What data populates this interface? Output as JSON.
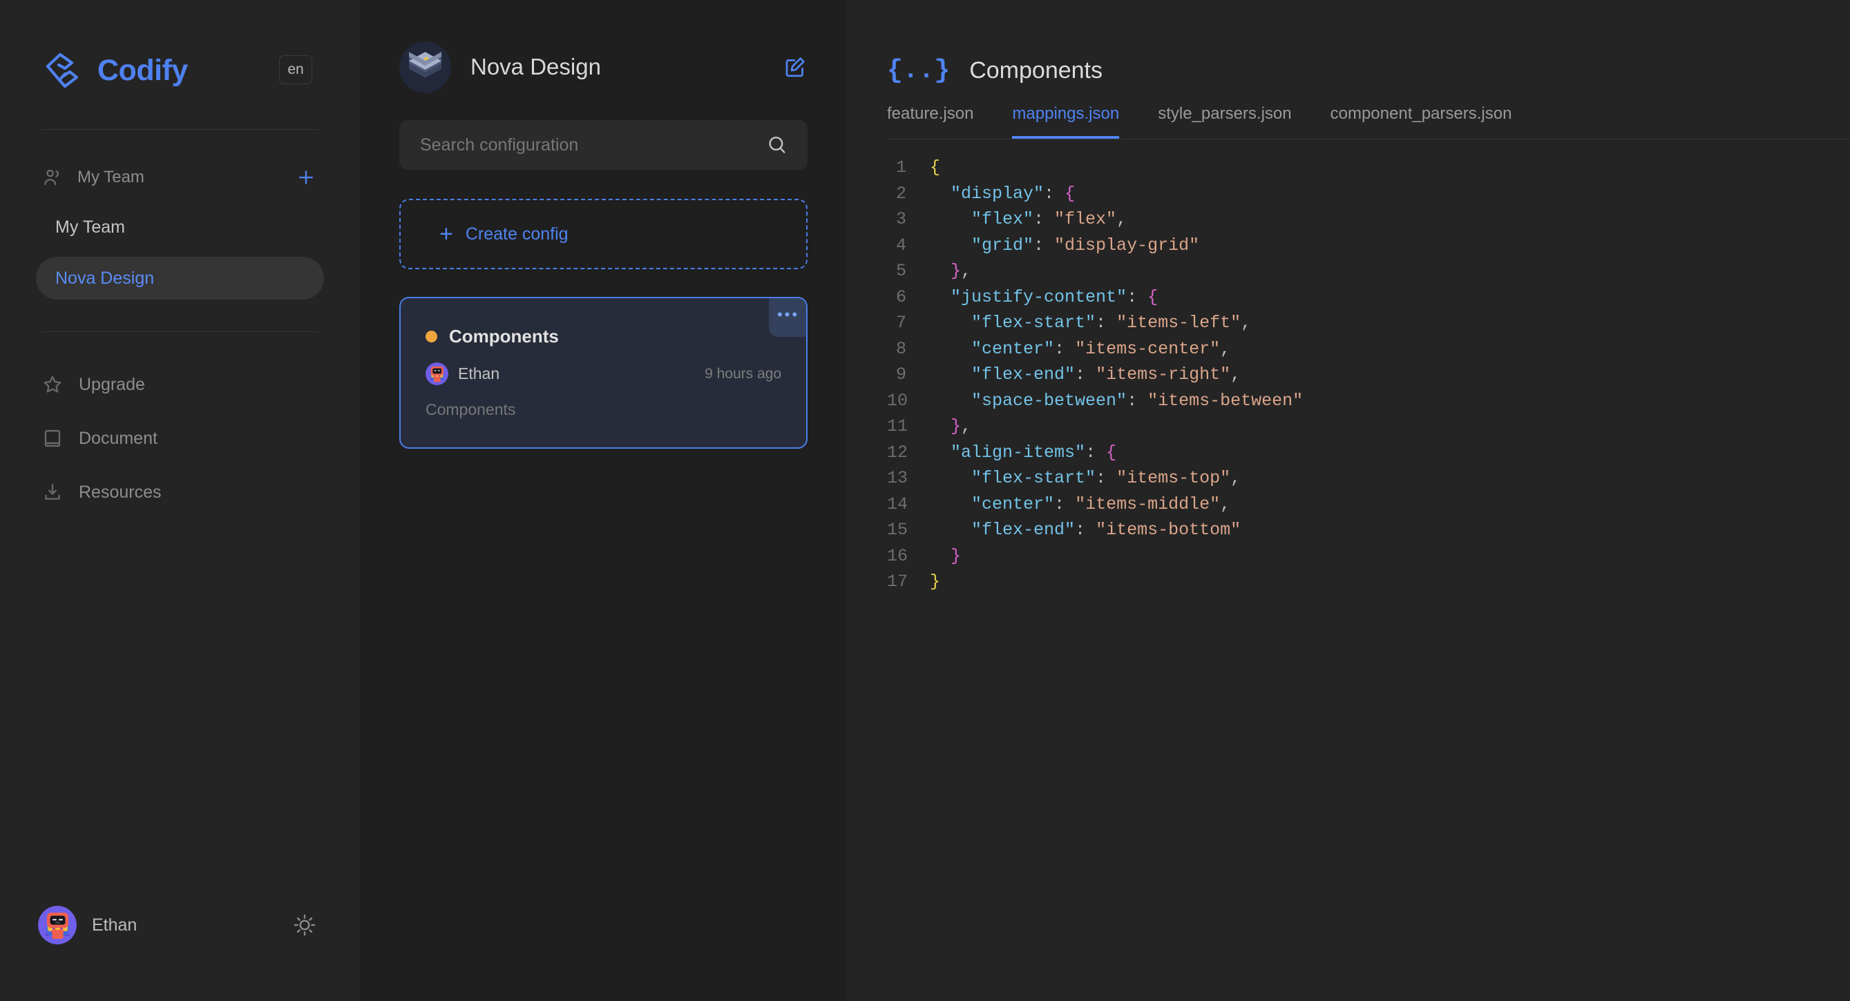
{
  "brand": {
    "name": "Codify",
    "lang_badge": "en"
  },
  "sidebar": {
    "team_section": {
      "label": "My Team",
      "add_label": "+"
    },
    "teams": [
      {
        "label": "My Team",
        "active": false
      },
      {
        "label": "Nova Design",
        "active": true
      }
    ],
    "nav": [
      {
        "label": "Upgrade",
        "icon": "star-icon"
      },
      {
        "label": "Document",
        "icon": "book-icon"
      },
      {
        "label": "Resources",
        "icon": "download-icon"
      }
    ],
    "user": {
      "name": "Ethan",
      "avatar": "robot-avatar",
      "theme_icon": "sun-icon"
    }
  },
  "middle": {
    "project_title": "Nova Design",
    "project_icon": "isometric-cube-icon",
    "edit_icon": "edit-square-icon",
    "search": {
      "value": "",
      "placeholder": "Search configuration",
      "icon": "search-icon"
    },
    "create_config": {
      "label": "Create config",
      "plus": "+"
    },
    "config_card": {
      "title": "Components",
      "status_color": "#f0a63c",
      "author": "Ethan",
      "timestamp": "9 hours ago",
      "description": "Components",
      "menu": "•••"
    }
  },
  "right": {
    "icon": "{..}",
    "title": "Components",
    "tabs": [
      {
        "label": "feature.json",
        "active": false
      },
      {
        "label": "mappings.json",
        "active": true
      },
      {
        "label": "style_parsers.json",
        "active": false
      },
      {
        "label": "component_parsers.json",
        "active": false
      }
    ],
    "code_lines": [
      {
        "n": "1",
        "tokens": [
          {
            "t": "{",
            "c": "br0"
          }
        ]
      },
      {
        "n": "2",
        "tokens": [
          {
            "t": "  ",
            "c": "pun"
          },
          {
            "t": "\"display\"",
            "c": "key"
          },
          {
            "t": ": ",
            "c": "pun"
          },
          {
            "t": "{",
            "c": "br1"
          }
        ]
      },
      {
        "n": "3",
        "tokens": [
          {
            "t": "    ",
            "c": "pun"
          },
          {
            "t": "\"flex\"",
            "c": "key"
          },
          {
            "t": ": ",
            "c": "pun"
          },
          {
            "t": "\"flex\"",
            "c": "str"
          },
          {
            "t": ",",
            "c": "pun"
          }
        ]
      },
      {
        "n": "4",
        "tokens": [
          {
            "t": "    ",
            "c": "pun"
          },
          {
            "t": "\"grid\"",
            "c": "key"
          },
          {
            "t": ": ",
            "c": "pun"
          },
          {
            "t": "\"display-grid\"",
            "c": "str"
          }
        ]
      },
      {
        "n": "5",
        "tokens": [
          {
            "t": "  ",
            "c": "pun"
          },
          {
            "t": "}",
            "c": "br1"
          },
          {
            "t": ",",
            "c": "pun"
          }
        ]
      },
      {
        "n": "6",
        "tokens": [
          {
            "t": "  ",
            "c": "pun"
          },
          {
            "t": "\"justify-content\"",
            "c": "key"
          },
          {
            "t": ": ",
            "c": "pun"
          },
          {
            "t": "{",
            "c": "br1"
          }
        ]
      },
      {
        "n": "7",
        "tokens": [
          {
            "t": "    ",
            "c": "pun"
          },
          {
            "t": "\"flex-start\"",
            "c": "key"
          },
          {
            "t": ": ",
            "c": "pun"
          },
          {
            "t": "\"items-left\"",
            "c": "str"
          },
          {
            "t": ",",
            "c": "pun"
          }
        ]
      },
      {
        "n": "8",
        "tokens": [
          {
            "t": "    ",
            "c": "pun"
          },
          {
            "t": "\"center\"",
            "c": "key"
          },
          {
            "t": ": ",
            "c": "pun"
          },
          {
            "t": "\"items-center\"",
            "c": "str"
          },
          {
            "t": ",",
            "c": "pun"
          }
        ]
      },
      {
        "n": "9",
        "tokens": [
          {
            "t": "    ",
            "c": "pun"
          },
          {
            "t": "\"flex-end\"",
            "c": "key"
          },
          {
            "t": ": ",
            "c": "pun"
          },
          {
            "t": "\"items-right\"",
            "c": "str"
          },
          {
            "t": ",",
            "c": "pun"
          }
        ]
      },
      {
        "n": "10",
        "tokens": [
          {
            "t": "    ",
            "c": "pun"
          },
          {
            "t": "\"space-between\"",
            "c": "key"
          },
          {
            "t": ": ",
            "c": "pun"
          },
          {
            "t": "\"items-between\"",
            "c": "str"
          }
        ]
      },
      {
        "n": "11",
        "tokens": [
          {
            "t": "  ",
            "c": "pun"
          },
          {
            "t": "}",
            "c": "br1"
          },
          {
            "t": ",",
            "c": "pun"
          }
        ]
      },
      {
        "n": "12",
        "tokens": [
          {
            "t": "  ",
            "c": "pun"
          },
          {
            "t": "\"align-items\"",
            "c": "key"
          },
          {
            "t": ": ",
            "c": "pun"
          },
          {
            "t": "{",
            "c": "br1"
          }
        ]
      },
      {
        "n": "13",
        "tokens": [
          {
            "t": "    ",
            "c": "pun"
          },
          {
            "t": "\"flex-start\"",
            "c": "key"
          },
          {
            "t": ": ",
            "c": "pun"
          },
          {
            "t": "\"items-top\"",
            "c": "str"
          },
          {
            "t": ",",
            "c": "pun"
          }
        ]
      },
      {
        "n": "14",
        "tokens": [
          {
            "t": "    ",
            "c": "pun"
          },
          {
            "t": "\"center\"",
            "c": "key"
          },
          {
            "t": ": ",
            "c": "pun"
          },
          {
            "t": "\"items-middle\"",
            "c": "str"
          },
          {
            "t": ",",
            "c": "pun"
          }
        ]
      },
      {
        "n": "15",
        "tokens": [
          {
            "t": "    ",
            "c": "pun"
          },
          {
            "t": "\"flex-end\"",
            "c": "key"
          },
          {
            "t": ": ",
            "c": "pun"
          },
          {
            "t": "\"items-bottom\"",
            "c": "str"
          }
        ]
      },
      {
        "n": "16",
        "tokens": [
          {
            "t": "  ",
            "c": "pun"
          },
          {
            "t": "}",
            "c": "br1"
          }
        ]
      },
      {
        "n": "17",
        "tokens": [
          {
            "t": "}",
            "c": "br0"
          }
        ]
      }
    ]
  },
  "colors": {
    "accent": "#4f84f2",
    "sidebar_bg": "#242424",
    "mid_bg": "#1f1f1f",
    "card_bg": "#272c3a",
    "status": "#f0a63c"
  }
}
